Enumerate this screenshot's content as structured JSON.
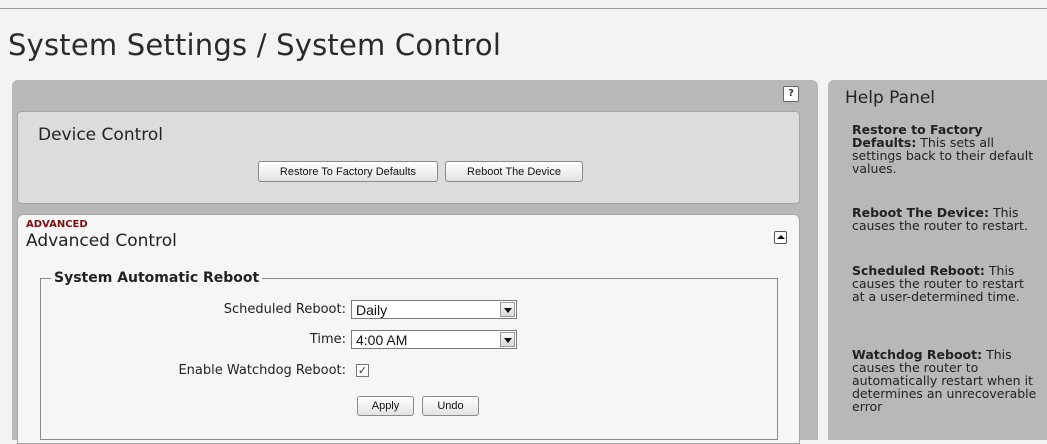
{
  "page_title": "System Settings / System Control",
  "help_button_label": "?",
  "device_control": {
    "title": "Device Control",
    "restore_label": "Restore To Factory Defaults",
    "reboot_label": "Reboot The Device"
  },
  "advanced": {
    "badge": "ADVANCED",
    "title": "Advanced Control",
    "fieldset_legend": "System Automatic Reboot",
    "scheduled_label": "Scheduled Reboot:",
    "scheduled_value": "Daily",
    "time_label": "Time:",
    "time_value": "4:00 AM",
    "watchdog_label": "Enable Watchdog Reboot:",
    "watchdog_checked": true,
    "apply_label": "Apply",
    "undo_label": "Undo"
  },
  "help_panel": {
    "title": "Help Panel",
    "items": [
      {
        "term": "Restore to Factory Defaults:",
        "desc": " This sets all settings back to their default values."
      },
      {
        "term": "Reboot The Device:",
        "desc": " This causes the router to restart."
      },
      {
        "term": "Scheduled Reboot:",
        "desc": " This causes the router to restart at a user-determined time."
      },
      {
        "term": "Watchdog Reboot:",
        "desc": " This causes the router to automatically restart when it determines an unrecoverable error"
      }
    ]
  },
  "icons": {
    "collapse": "collapse-up-icon",
    "dropdown": "chevron-down-icon",
    "check": "checkmark-icon"
  }
}
